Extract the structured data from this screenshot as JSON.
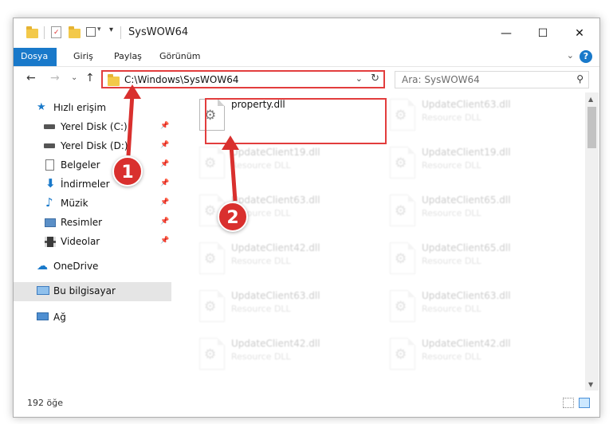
{
  "window": {
    "title": "SysWOW64",
    "controls": {
      "minimize": "—",
      "maximize": "☐",
      "close": "✕"
    }
  },
  "ribbon": {
    "tabs": [
      {
        "label": "Dosya",
        "active": true
      },
      {
        "label": "Giriş",
        "active": false
      },
      {
        "label": "Paylaş",
        "active": false
      },
      {
        "label": "Görünüm",
        "active": false
      }
    ],
    "help": "?",
    "collapse": "⌄"
  },
  "nav": {
    "back": "←",
    "forward": "→",
    "recent": "⌄",
    "up": "↑",
    "address": "C:\\Windows\\SysWOW64",
    "address_dropdown": "⌄",
    "refresh": "↻",
    "search_placeholder": "Ara: SysWOW64",
    "search_icon": "⚲"
  },
  "sidebar": {
    "quick_access": "Hızlı erişim",
    "items": [
      {
        "label": "Yerel Disk (C:)",
        "icon": "drive-icon"
      },
      {
        "label": "Yerel Disk (D:)",
        "icon": "drive-icon"
      },
      {
        "label": "Belgeler",
        "icon": "documents-icon"
      },
      {
        "label": "İndirmeler",
        "icon": "downloads-icon"
      },
      {
        "label": "Müzik",
        "icon": "music-icon"
      },
      {
        "label": "Resimler",
        "icon": "pictures-icon"
      },
      {
        "label": "Videolar",
        "icon": "videos-icon"
      }
    ],
    "onedrive": "OneDrive",
    "this_pc": "Bu bilgisayar",
    "network": "Ağ"
  },
  "files": [
    {
      "name": "property.dll",
      "type": ""
    },
    {
      "name": "UpdateClient63.dll",
      "type": "Resource DLL"
    },
    {
      "name": "UpdateClient19.dll",
      "type": "Resource DLL"
    },
    {
      "name": "UpdateClient19.dll",
      "type": "Resource DLL"
    },
    {
      "name": "UpdateClient63.dll",
      "type": "Resource DLL"
    },
    {
      "name": "UpdateClient65.dll",
      "type": "Resource DLL"
    },
    {
      "name": "UpdateClient42.dll",
      "type": "Resource DLL"
    },
    {
      "name": "UpdateClient65.dll",
      "type": "Resource DLL"
    },
    {
      "name": "UpdateClient63.dll",
      "type": "Resource DLL"
    },
    {
      "name": "UpdateClient63.dll",
      "type": "Resource DLL"
    },
    {
      "name": "UpdateClient42.dll",
      "type": "Resource DLL"
    },
    {
      "name": "UpdateClient42.dll",
      "type": "Resource DLL"
    }
  ],
  "status": {
    "count": "192 öğe"
  },
  "annotations": {
    "step1": "1",
    "step2": "2",
    "color": "#d9302e"
  }
}
